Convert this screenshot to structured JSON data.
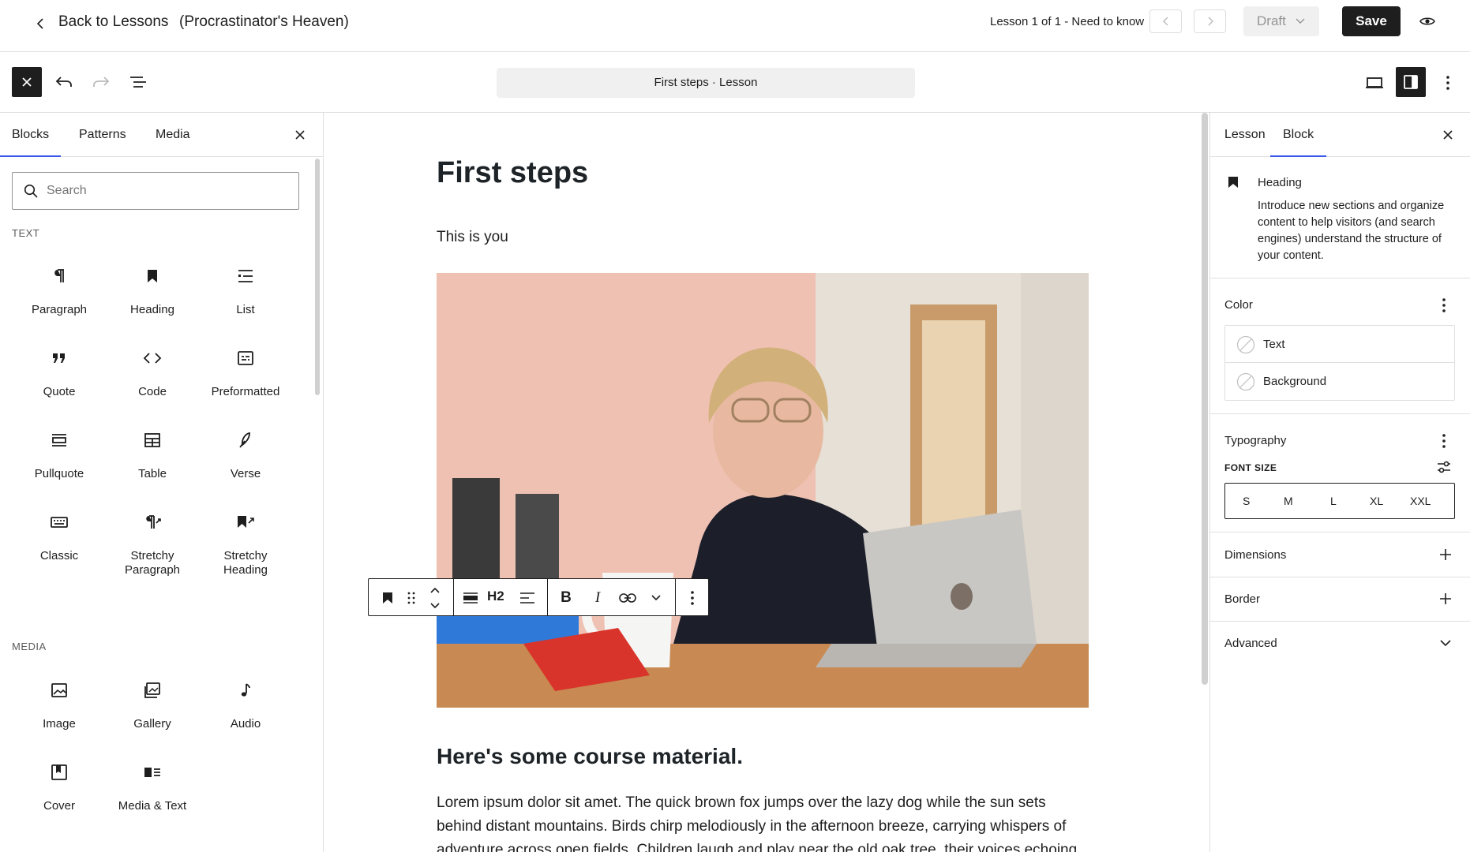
{
  "topbar": {
    "back_label": "Back to Lessons",
    "course_title": "(Procrastinator's Heaven)",
    "lesson_info": "Lesson 1 of 1 - Need to know",
    "draft_label": "Draft",
    "save_label": "Save"
  },
  "toolbar": {
    "doc_title": "First steps · Lesson"
  },
  "inserter": {
    "tabs": [
      "Blocks",
      "Patterns",
      "Media"
    ],
    "search_placeholder": "Search",
    "text_section": "TEXT",
    "media_section": "MEDIA",
    "text_blocks": [
      {
        "label": "Paragraph",
        "icon": "paragraph-icon"
      },
      {
        "label": "Heading",
        "icon": "heading-icon"
      },
      {
        "label": "List",
        "icon": "list-icon"
      },
      {
        "label": "Quote",
        "icon": "quote-icon"
      },
      {
        "label": "Code",
        "icon": "code-icon"
      },
      {
        "label": "Preformatted",
        "icon": "preformatted-icon"
      },
      {
        "label": "Pullquote",
        "icon": "pullquote-icon"
      },
      {
        "label": "Table",
        "icon": "table-icon"
      },
      {
        "label": "Verse",
        "icon": "verse-icon"
      },
      {
        "label": "Classic",
        "icon": "classic-icon"
      },
      {
        "label": "Stretchy\nParagraph",
        "icon": "stretchy-paragraph-icon"
      },
      {
        "label": "Stretchy\nHeading",
        "icon": "stretchy-heading-icon"
      }
    ],
    "media_blocks": [
      {
        "label": "Image",
        "icon": "image-icon"
      },
      {
        "label": "Gallery",
        "icon": "gallery-icon"
      },
      {
        "label": "Audio",
        "icon": "audio-icon"
      },
      {
        "label": "Cover",
        "icon": "cover-icon"
      },
      {
        "label": "Media & Text",
        "icon": "media-text-icon"
      }
    ]
  },
  "editor": {
    "title": "First steps",
    "intro": "This is you",
    "heading": "Here's some course material.",
    "body": "Lorem ipsum dolor sit amet. The quick brown fox jumps over the lazy dog while the sun sets behind distant mountains. Birds chirp melodiously in the afternoon breeze, carrying whispers of adventure across open fields. Children laugh and play near the old oak tree, their voices echoing",
    "block_toolbar": {
      "heading_level": "H2"
    }
  },
  "settings": {
    "tabs": [
      "Lesson",
      "Block"
    ],
    "block_name": "Heading",
    "block_description": "Introduce new sections and organize content to help visitors (and search engines) understand the structure of your content.",
    "color_title": "Color",
    "color_items": [
      "Text",
      "Background"
    ],
    "typography_title": "Typography",
    "font_size_label": "FONT SIZE",
    "font_sizes": [
      "S",
      "M",
      "L",
      "XL",
      "XXL"
    ],
    "dimensions_title": "Dimensions",
    "border_title": "Border",
    "advanced_title": "Advanced"
  },
  "colors": {
    "accent": "#3858e9",
    "dark": "#1e1e1e",
    "heading": "#1d2327"
  }
}
